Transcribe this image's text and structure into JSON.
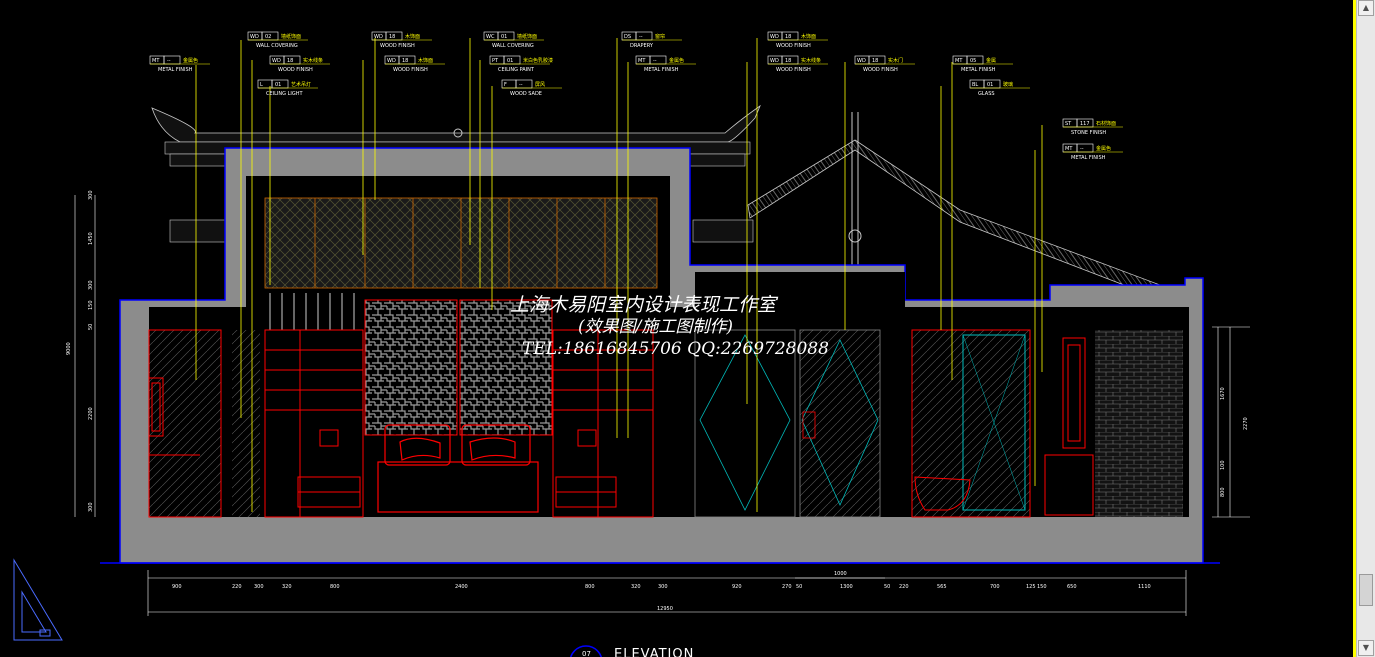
{
  "watermark": {
    "line1": "上海木易阳室内设计表现工作室",
    "line2": "(效果图/施工图制作)",
    "line3": "TEL:18616845706 QQ:2269728088"
  },
  "elevation": {
    "title": "ELEVATION",
    "number": "07"
  },
  "tags": [
    {
      "code": "WD",
      "num": "02",
      "cn": "墙纸饰面",
      "en": "WALL COVERING"
    },
    {
      "code": "WD",
      "num": "18",
      "cn": "实木线条",
      "en": "WOOD FINISH"
    },
    {
      "code": "L",
      "num": "01",
      "cn": "艺术吊灯",
      "en": "CEILING LIGHT"
    },
    {
      "code": "MT",
      "num": "--",
      "cn": "金属色",
      "en": "METAL FINISH"
    },
    {
      "code": "WD",
      "num": "18",
      "cn": "木饰面",
      "en": "WOOD FINISH"
    },
    {
      "code": "WD",
      "num": "18",
      "cn": "木饰面",
      "en": "WOOD FINISH"
    },
    {
      "code": "WC",
      "num": "01",
      "cn": "墙纸饰面",
      "en": "WALL COVERING"
    },
    {
      "code": "PT",
      "num": "01",
      "cn": "米白色乳胶漆",
      "en": "CEILING PAINT"
    },
    {
      "code": "F",
      "num": "--",
      "cn": "屏风",
      "en": "WOOD SADE"
    },
    {
      "code": "DS",
      "num": "--",
      "cn": "窗帘",
      "en": "DRAPERY"
    },
    {
      "code": "MT",
      "num": "--",
      "cn": "金属色",
      "en": "METAL FINISH"
    },
    {
      "code": "WD",
      "num": "18",
      "cn": "木饰面",
      "en": "WOOD FINISH"
    },
    {
      "code": "WD",
      "num": "18",
      "cn": "实木线条",
      "en": "WOOD FINISH"
    },
    {
      "code": "WD",
      "num": "18",
      "cn": "实木门",
      "en": "WOOD FINISH"
    },
    {
      "code": "MT",
      "num": "05",
      "cn": "金属",
      "en": "METAL FINISH"
    },
    {
      "code": "BL",
      "num": "01",
      "cn": "玻璃",
      "en": "GLASS"
    },
    {
      "code": "ST",
      "num": "117",
      "cn": "石材饰面",
      "en": "STONE FINISH"
    },
    {
      "code": "MT",
      "num": "--",
      "cn": "金属色",
      "en": "METAL FINISH"
    }
  ],
  "dims_bottom": [
    "900",
    "220",
    "300",
    "320",
    "800",
    "2400",
    "800",
    "320",
    "300",
    "920",
    "270",
    "50",
    "1300",
    "50",
    "220",
    "565",
    "700",
    "125",
    "150",
    "650",
    "1110"
  ],
  "dims_overall": "12950",
  "dims_door": "1000",
  "dims_left": [
    "300",
    "1450",
    "300",
    "150",
    "50",
    "9000",
    "2200",
    "300"
  ],
  "dims_right": [
    "1670",
    "2270",
    "100",
    "800"
  ],
  "colors": {
    "background": "#000000",
    "wall_section": "#8c8c8c",
    "outline": "#0000ff",
    "furniture": "#ff0000",
    "leader": "#ffff00",
    "frame": "#ffff00"
  }
}
